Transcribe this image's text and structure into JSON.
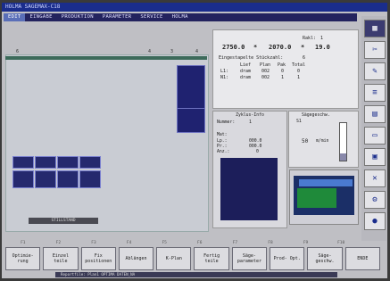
{
  "window": {
    "title": "HOLMA SAGEMAX-C18"
  },
  "menu": [
    {
      "label": "EDIT",
      "active": true
    },
    {
      "label": "EINGABE",
      "active": false
    },
    {
      "label": "PRODUKTION",
      "active": false
    },
    {
      "label": "PARAMETER",
      "active": false
    },
    {
      "label": "SERVICE",
      "active": false
    },
    {
      "label": "HOLMA",
      "active": false
    }
  ],
  "ruler": {
    "labels": [
      "6",
      "4",
      "3",
      "4"
    ]
  },
  "statusbar": {
    "text": "STILLSTAND"
  },
  "info": {
    "raklen_label": "Rakl:",
    "raklen_value": "1",
    "dims": [
      "2750.0",
      "*",
      "2070.0",
      "*",
      "19.0"
    ],
    "zuschnitt_label": "Eingestapelte Stückzahl:",
    "zuschnitt_value": "6",
    "col_headers": [
      "Lief",
      "Plan",
      "Pak",
      "Total"
    ],
    "rows": [
      {
        "name": "L1:",
        "lief": "dram",
        "plan": "002",
        "pak": "0",
        "total": "0"
      },
      {
        "name": "N1:",
        "lief": "dram",
        "plan": "002",
        "pak": "1",
        "total": "1"
      }
    ]
  },
  "cycle": {
    "title": "Zyklus-Info",
    "nummer_label": "Nummer:",
    "nummer_value": "1",
    "mat_label": "Mat:",
    "lines": [
      {
        "label": "Lp.:",
        "value": "000.0"
      },
      {
        "label": "Pr.:",
        "value": "000.0"
      },
      {
        "label": "Anz.:",
        "value": "0"
      }
    ]
  },
  "saw": {
    "title": "Sägegeschw.",
    "sub": "S1 ",
    "speed_value": "50",
    "speed_unit": "m/min",
    "gauge_level": 0.18
  },
  "toolbar": [
    {
      "icon": "grid-icon",
      "glyph": "▦"
    },
    {
      "icon": "saw-icon",
      "glyph": "✂"
    },
    {
      "icon": "edit-icon",
      "glyph": "✎"
    },
    {
      "icon": "stack-icon",
      "glyph": "≡"
    },
    {
      "icon": "layers-icon",
      "glyph": "▤"
    },
    {
      "icon": "document-icon",
      "glyph": "▭"
    },
    {
      "icon": "save-icon",
      "glyph": "▣"
    },
    {
      "icon": "close-icon",
      "glyph": "✕"
    },
    {
      "icon": "settings-icon",
      "glyph": "⚙"
    },
    {
      "icon": "power-icon",
      "glyph": "●"
    }
  ],
  "fkeys": [
    "F1",
    "F2",
    "F3",
    "F4",
    "F5",
    "F6",
    "F7",
    "F8",
    "F9",
    "F10"
  ],
  "buttons": [
    "Optimie- rung",
    "Einzel teile",
    "Fix positionen",
    "Ablängen",
    "K-Plan",
    "Fertig teile",
    "Säge- parameter",
    "Prod- Opt.",
    "Säge- geschw.",
    "ENDE"
  ],
  "bottom": {
    "text": "Reportfile: Plan1 OPTIMA  DATEN_NA"
  }
}
